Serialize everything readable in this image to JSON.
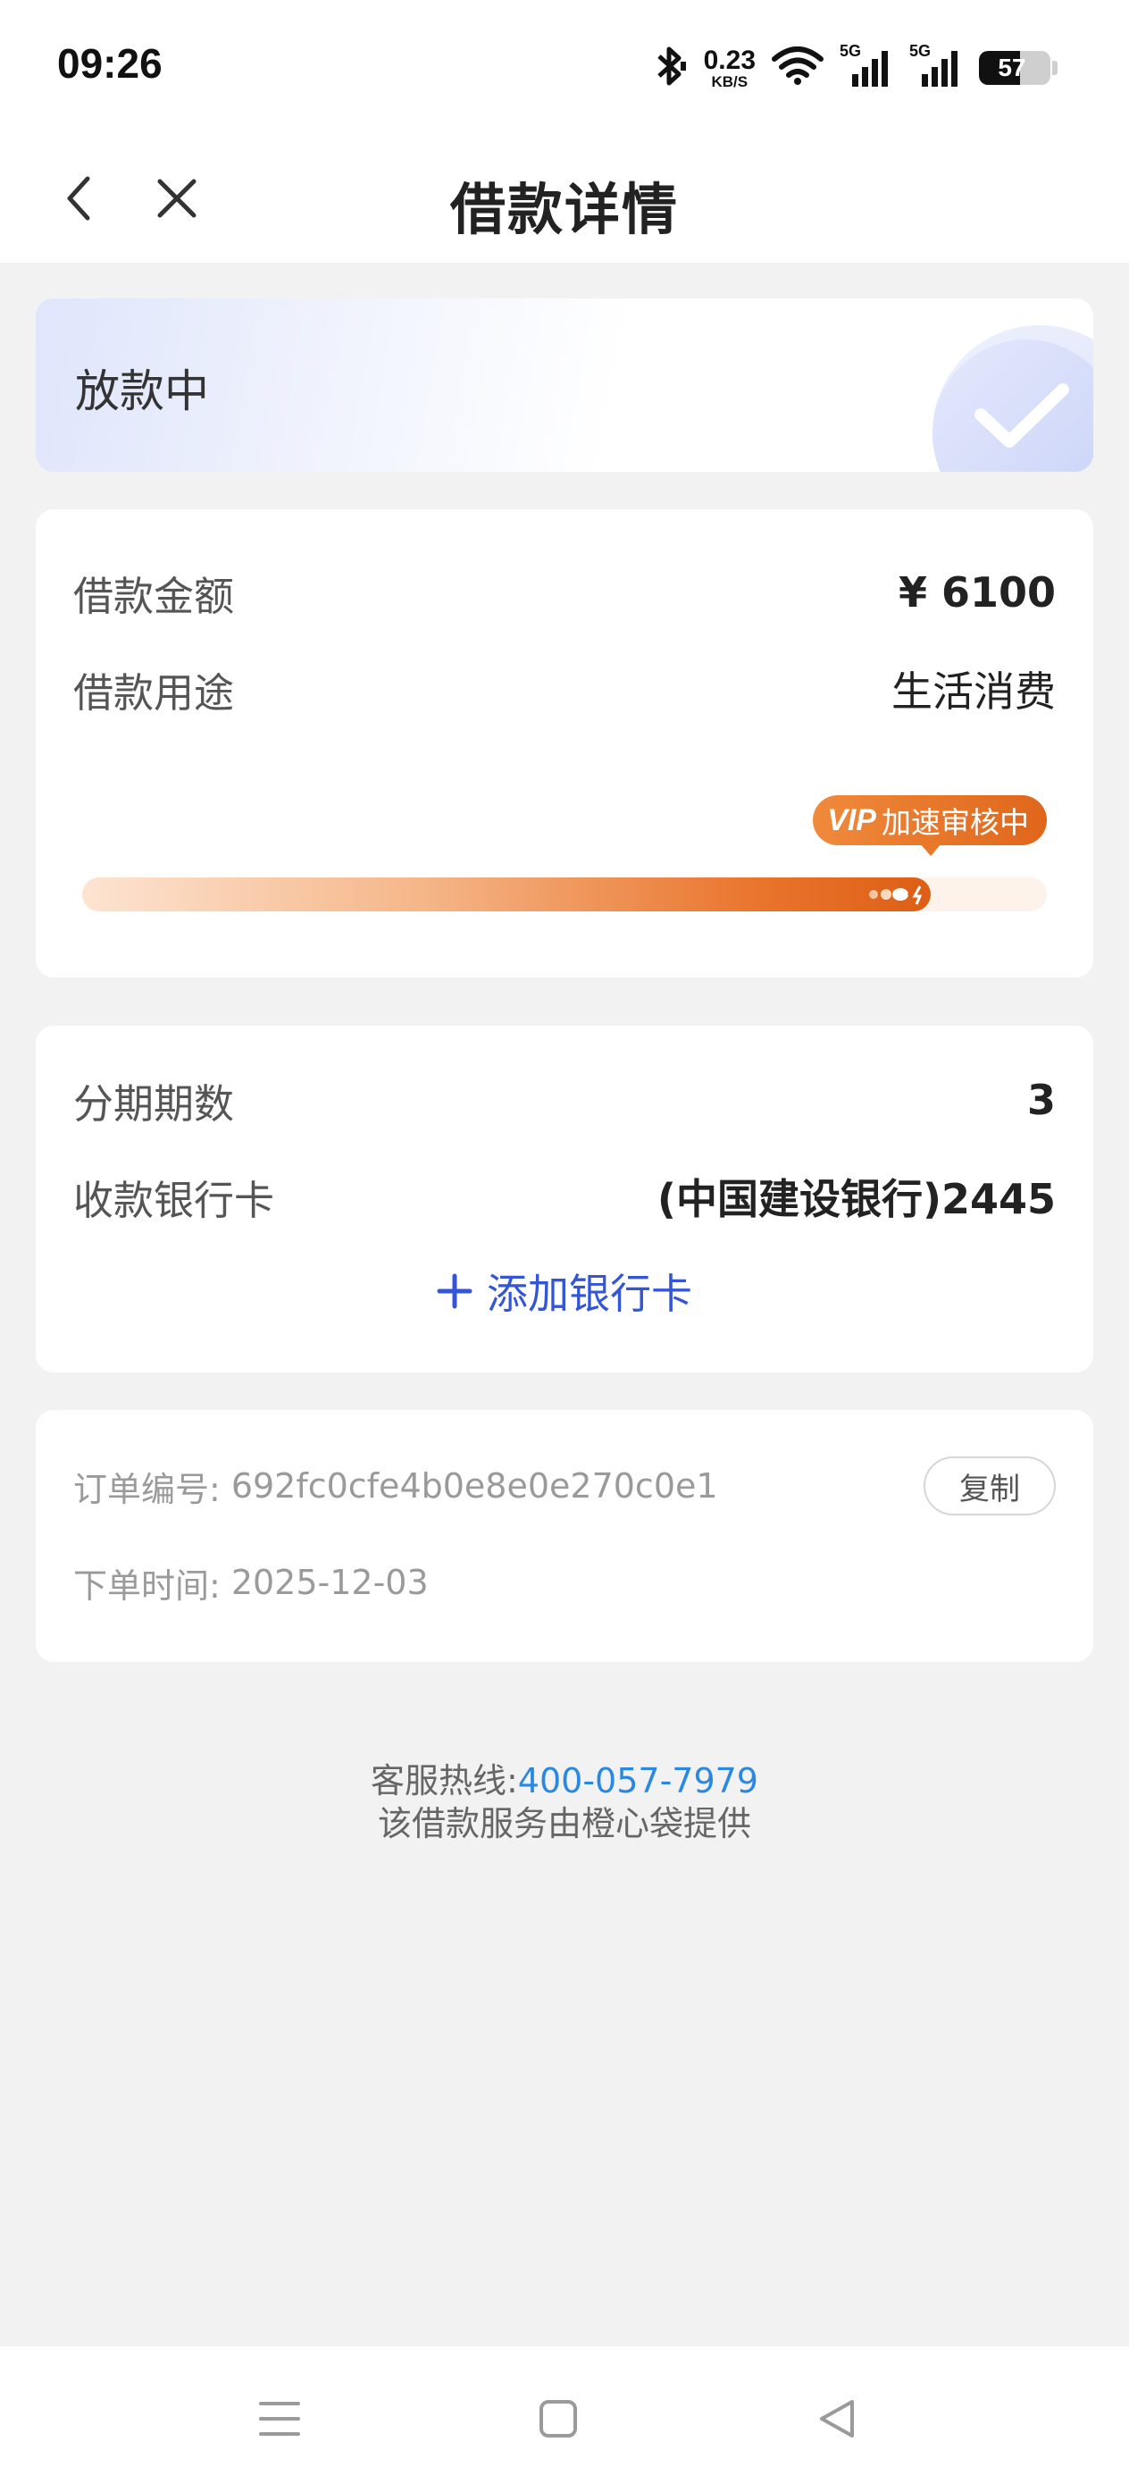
{
  "status_bar": {
    "time": "09:26",
    "net_speed_value": "0.23",
    "net_speed_unit": "KB/S",
    "signal_1_label": "5G",
    "signal_2_label": "5G",
    "battery_level": "57",
    "battery_fraction": 0.57
  },
  "nav": {
    "title": "借款详情",
    "back_icon": "chevron-left-icon",
    "close_icon": "close-icon"
  },
  "status_card": {
    "status": "放款中",
    "icon": "check-icon"
  },
  "loan_card": {
    "amount_label": "借款金额",
    "amount_value": "¥ 6100",
    "purpose_label": "借款用途",
    "purpose_value": "生活消费",
    "vip_tag": "VIP",
    "vip_text": "加速审核中",
    "progress_fraction": 0.88
  },
  "bank_card": {
    "installments_label": "分期期数",
    "installments_value": "3",
    "bank_label": "收款银行卡",
    "bank_value": "(中国建设银行)2445",
    "add_card_label": "添加银行卡"
  },
  "order_card": {
    "order_no_label": "订单编号:",
    "order_no_value": "692fc0cfe4b0e8e0e270c0e1",
    "copy_label": "复制",
    "order_time_label": "下单时间:",
    "order_time_value": "2025-12-03"
  },
  "footer": {
    "hotline_label": "客服热线:",
    "hotline_number": "400-057-7979",
    "provider_text": "该借款服务由橙心袋提供"
  },
  "colors": {
    "accent_blue": "#3456d6",
    "link_blue": "#2b88e0",
    "vip_orange": "#e0661a",
    "background": "#f2f2f2"
  }
}
